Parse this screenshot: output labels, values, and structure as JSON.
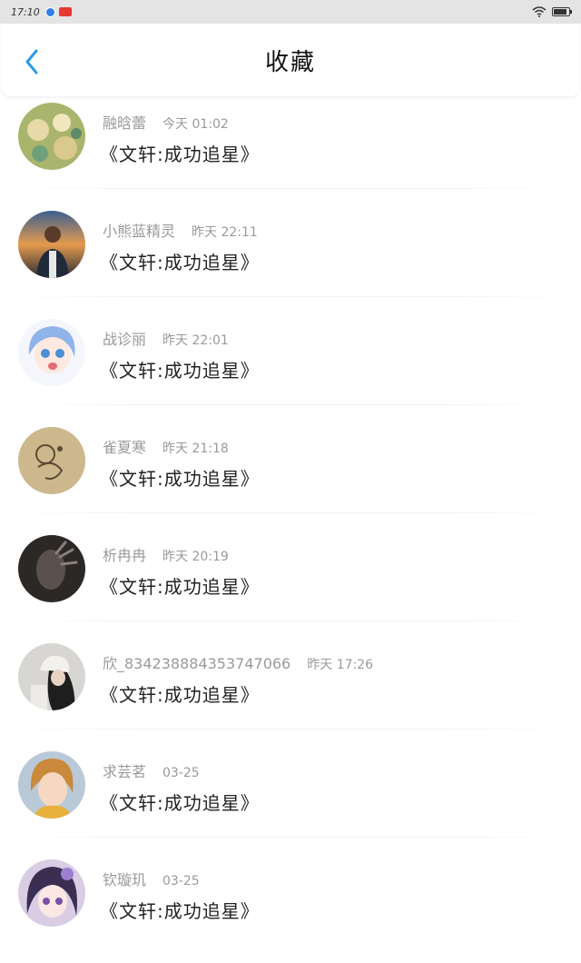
{
  "status_bar": {
    "time": "17:10",
    "battery_level": 0.85
  },
  "header": {
    "title": "收藏"
  },
  "items": [
    {
      "user": "融晗蕾",
      "time": "今天 01:02",
      "title": "《文轩:成功追星》"
    },
    {
      "user": "小熊蓝精灵",
      "time": "昨天 22:11",
      "title": "《文轩:成功追星》"
    },
    {
      "user": "战诊丽",
      "time": "昨天 22:01",
      "title": "《文轩:成功追星》"
    },
    {
      "user": "雀夏寒",
      "time": "昨天 21:18",
      "title": "《文轩:成功追星》"
    },
    {
      "user": "析冉冉",
      "time": "昨天 20:19",
      "title": "《文轩:成功追星》"
    },
    {
      "user": "欣_834238884353747066",
      "time": "昨天 17:26",
      "title": "《文轩:成功追星》"
    },
    {
      "user": "求芸茗",
      "time": "03-25",
      "title": "《文轩:成功追星》"
    },
    {
      "user": "钦璇玑",
      "time": "03-25",
      "title": "《文轩:成功追星》"
    }
  ]
}
